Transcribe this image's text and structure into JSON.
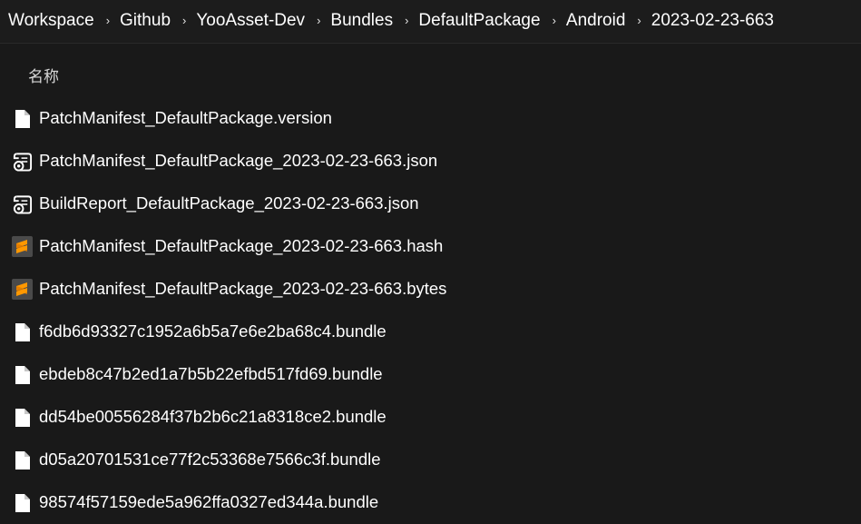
{
  "breadcrumb": [
    "Workspace",
    "Github",
    "YooAsset-Dev",
    "Bundles",
    "DefaultPackage",
    "Android",
    "2023-02-23-663"
  ],
  "breadcrumb_separator": "›",
  "column_header": "名称",
  "colors": {
    "background": "#191919",
    "sublime_orange": "#ff9800",
    "sublime_tile": "#4a4a4a"
  },
  "files": [
    {
      "name": "PatchManifest_DefaultPackage.version",
      "icon": "blank-file-icon"
    },
    {
      "name": "PatchManifest_DefaultPackage_2023-02-23-663.json",
      "icon": "script-file-icon"
    },
    {
      "name": "BuildReport_DefaultPackage_2023-02-23-663.json",
      "icon": "script-file-icon"
    },
    {
      "name": "PatchManifest_DefaultPackage_2023-02-23-663.hash",
      "icon": "sublime-text-icon"
    },
    {
      "name": "PatchManifest_DefaultPackage_2023-02-23-663.bytes",
      "icon": "sublime-text-icon"
    },
    {
      "name": "f6db6d93327c1952a6b5a7e6e2ba68c4.bundle",
      "icon": "blank-file-icon"
    },
    {
      "name": "ebdeb8c47b2ed1a7b5b22efbd517fd69.bundle",
      "icon": "blank-file-icon"
    },
    {
      "name": "dd54be00556284f37b2b6c21a8318ce2.bundle",
      "icon": "blank-file-icon"
    },
    {
      "name": "d05a20701531ce77f2c53368e7566c3f.bundle",
      "icon": "blank-file-icon"
    },
    {
      "name": "98574f57159ede5a962ffa0327ed344a.bundle",
      "icon": "blank-file-icon"
    }
  ]
}
